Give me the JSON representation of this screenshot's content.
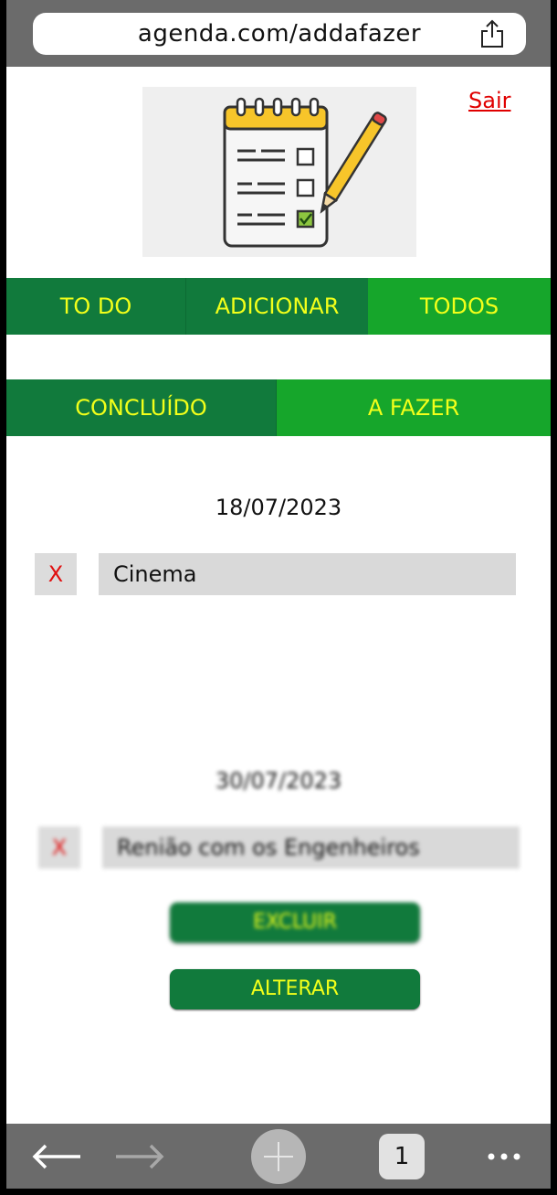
{
  "browser": {
    "url": "agenda.com/addafazer",
    "tab_count": "1",
    "icons": [
      "share-icon",
      "back-arrow-icon",
      "forward-arrow-icon",
      "new-tab-icon",
      "more-icon"
    ]
  },
  "header": {
    "logo_icon": "checklist-pencil-icon",
    "logout_label": "Sair"
  },
  "nav": {
    "tabs": [
      {
        "label": "TO DO"
      },
      {
        "label": "ADICIONAR"
      },
      {
        "label": "TODOS"
      }
    ]
  },
  "filters": {
    "tabs": [
      {
        "label": "CONCLUÍDO"
      },
      {
        "label": "A FAZER"
      }
    ]
  },
  "tasks": [
    {
      "date": "18/07/2023",
      "delete_label": "X",
      "title": "Cinema"
    },
    {
      "date": "30/07/2023",
      "delete_label": "X",
      "title": "Renião com os Engenheiros"
    }
  ],
  "actions": {
    "delete_label": "EXCLUIR",
    "edit_label": "ALTERAR"
  },
  "colors": {
    "dark_green": "#117a3c",
    "bright_green": "#16a62b",
    "label_yellow": "#f2ff1a",
    "logout_red": "#e00000",
    "chrome_gray": "#6b6b6b"
  }
}
